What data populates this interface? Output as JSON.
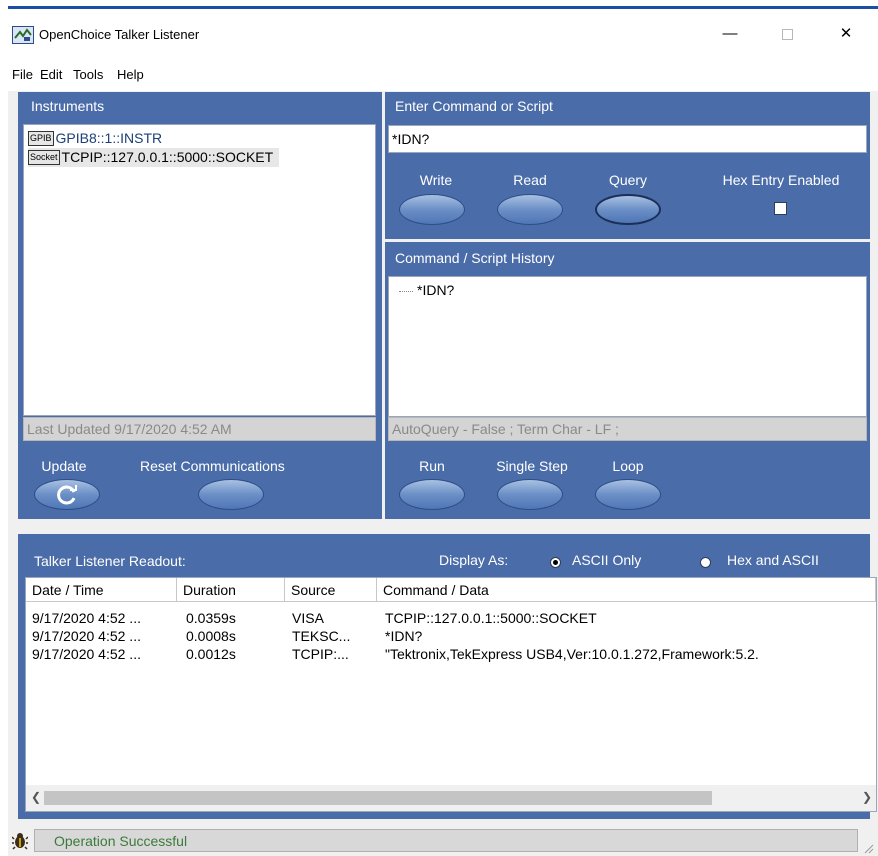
{
  "window": {
    "title": "OpenChoice Talker Listener"
  },
  "menu": [
    "File",
    "Edit",
    "Tools",
    "Help"
  ],
  "instruments": {
    "title": "Instruments",
    "items": [
      {
        "tag": "GPIB",
        "name": "GPIB8::1::INSTR"
      },
      {
        "tag": "Socket",
        "name": "TCPIP::127.0.0.1::5000::SOCKET"
      }
    ],
    "last_updated": "Last Updated 9/17/2020 4:52 AM",
    "update_label": "Update",
    "reset_label": "Reset Communications"
  },
  "command": {
    "title": "Enter Command or Script",
    "value": "*IDN?",
    "write_label": "Write",
    "read_label": "Read",
    "query_label": "Query",
    "hex_label": "Hex Entry Enabled"
  },
  "history": {
    "title": "Command / Script History",
    "items": [
      "*IDN?"
    ],
    "status": "AutoQuery - False ; Term Char - LF  ;",
    "run_label": "Run",
    "single_step_label": "Single Step",
    "loop_label": "Loop"
  },
  "readout": {
    "title": "Talker Listener Readout:",
    "display_as_label": "Display As:",
    "option_ascii": "ASCII Only",
    "option_hex": "Hex and ASCII",
    "columns": [
      "Date / Time",
      "Duration",
      "Source",
      "Command / Data"
    ],
    "rows": [
      [
        "9/17/2020 4:52 ...",
        "0.0359s",
        "VISA",
        "TCPIP::127.0.0.1::5000::SOCKET"
      ],
      [
        "9/17/2020 4:52 ...",
        "0.0008s",
        "TEKSC...",
        "*IDN?"
      ],
      [
        "9/17/2020 4:52 ...",
        "0.0012s",
        "TCPIP:...",
        "\"Tektronix,TekExpress USB4,Ver:10.0.1.272,Framework:5.2."
      ]
    ]
  },
  "status_bar": {
    "text": "Operation Successful"
  }
}
